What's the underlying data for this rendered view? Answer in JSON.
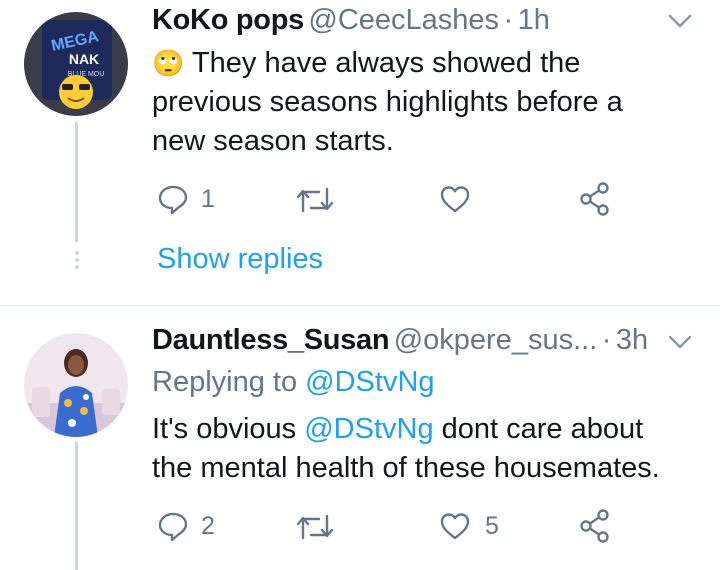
{
  "tweet1": {
    "display_name": "KoKo pops",
    "handle": "@CeecLashes",
    "sep": "·",
    "time": "1h",
    "emoji": "🙄",
    "text": "They have always showed the previous seasons highlights before a new season starts.",
    "reply_count": "1",
    "retweet_count": "",
    "like_count": "",
    "show_replies": "Show replies",
    "avatar_text": "MEGA NAK BLUE MOU"
  },
  "tweet2": {
    "display_name": "Dauntless_Susan",
    "handle": "@okpere_sus...",
    "sep": "·",
    "time": "3h",
    "replying_prefix": "Replying to ",
    "replying_handle": "@DStvNg",
    "text_before": "It's obvious ",
    "text_mention": "@DStvNg",
    "text_after": " dont care about the mental health of these housemates.",
    "reply_count": "2",
    "retweet_count": "",
    "like_count": "5"
  },
  "icons": [
    "reply-icon",
    "retweet-icon",
    "like-icon",
    "share-icon",
    "chevron-down-icon"
  ],
  "colors": {
    "accent": "#1da1f2",
    "secondary_text": "#657786",
    "divider": "#e1e8ed"
  }
}
